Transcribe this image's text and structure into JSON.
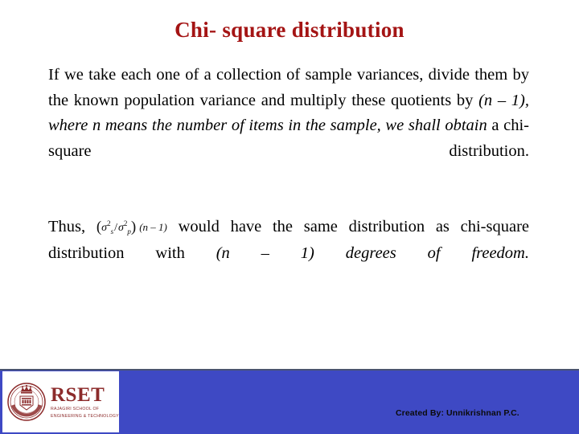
{
  "slide": {
    "title": "Chi- square distribution",
    "title_color": "#a41414",
    "background_color": "#ffffff"
  },
  "body": {
    "paragraph_1": {
      "segment_roman_1": "If we take each one of a collection of sample variances, divide them by the known population variance and multiply these quotients by ",
      "segment_italic_1": "(n – 1), where n means the number of items in the sample, we shall obtain ",
      "segment_roman_2": "a chi-square distribution."
    },
    "paragraph_2": {
      "segment_roman_1": "Thus, ",
      "equation": {
        "open_paren": "(",
        "sigma": "σ",
        "exponent": "2",
        "subscript_numerator": "s",
        "slash": "/",
        "subscript_denominator": "p",
        "close_paren": ")",
        "factor": "(n – 1)",
        "plain_text": "(σ²s / σ²p) (n – 1)"
      },
      "segment_roman_2": " would have the same distribution as chi-square distribution with ",
      "segment_italic_1": "(n – 1) degrees of freedom."
    }
  },
  "footer": {
    "band_color": "#3e49c4",
    "logo": {
      "crest_icon": "rajagiri-crest-icon",
      "acronym": "RSET",
      "subtitle_line_1": "RAJAGIRI SCHOOL OF",
      "subtitle_line_2": "ENGINEERING & TECHNOLOGY",
      "color": "#8c2b2b"
    },
    "credit": "Created By: Unnikrishnan P.C."
  }
}
